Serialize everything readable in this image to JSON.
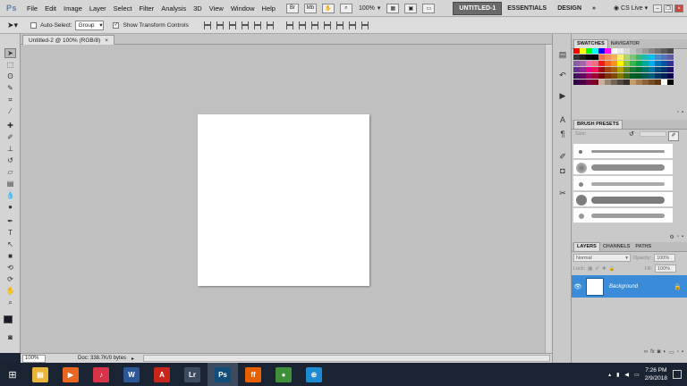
{
  "app": {
    "logo": "Ps"
  },
  "menu": [
    "File",
    "Edit",
    "Image",
    "Layer",
    "Select",
    "Filter",
    "Analysis",
    "3D",
    "View",
    "Window",
    "Help"
  ],
  "zoom_menu": "100%",
  "workspaces": {
    "active": "UNTITLED-1",
    "essentials": "ESSENTIALS",
    "design": "DESIGN",
    "more": "»"
  },
  "cs_live": "CS Live",
  "options": {
    "auto_select_label": "Auto-Select:",
    "auto_select_value": "Group",
    "show_transform_label": "Show Transform Controls",
    "show_transform_checked": "✓"
  },
  "document": {
    "tab_title": "Untitled-2 @ 100% (RGB/8)",
    "close": "×"
  },
  "status": {
    "zoom": "100%",
    "doc_info": "Doc: 338.7K/0 bytes",
    "arrow": "▸"
  },
  "panels": {
    "swatches_tab": "SWATCHES",
    "navigator_tab": "NAVIGATOR",
    "brush_presets_tab": "BRUSH PRESETS",
    "brush_size_label": "Size:",
    "layers_tab": "LAYERS",
    "channels_tab": "CHANNELS",
    "paths_tab": "PATHS",
    "blend_mode": "Normal",
    "opacity_label": "Opacity:",
    "opacity_value": "100%",
    "lock_label": "Lock:",
    "fill_label": "Fill:",
    "fill_value": "100%",
    "layer_name": "Background"
  },
  "swatch_colors": [
    "#ff0000",
    "#ffff00",
    "#00ff00",
    "#00ffff",
    "#0000ff",
    "#ff00ff",
    "#ffffff",
    "#ebebeb",
    "#d6d6d6",
    "#c2c2c2",
    "#adadad",
    "#999999",
    "#858585",
    "#707070",
    "#5c5c5c",
    "#474747",
    "#333333",
    "#1f1f1f",
    "#0a0a0a",
    "#000000",
    "#f26c4f",
    "#f68e55",
    "#fbaf5c",
    "#fff467",
    "#acd372",
    "#7cc576",
    "#3bb878",
    "#1abbb4",
    "#00bff3",
    "#438ccb",
    "#5574b9",
    "#605ca8",
    "#855fa8",
    "#a763a9",
    "#ef6ea8",
    "#f16d7e",
    "#ed1c24",
    "#f26522",
    "#f7941d",
    "#fff200",
    "#8dc63f",
    "#39b54a",
    "#00a651",
    "#00a99d",
    "#00aeef",
    "#0072bc",
    "#0054a6",
    "#2e3192",
    "#662d91",
    "#92278f",
    "#ec008c",
    "#ed145b",
    "#9e0b0f",
    "#a0410d",
    "#a36209",
    "#aba000",
    "#598527",
    "#1a7b30",
    "#007236",
    "#00746b",
    "#0076a3",
    "#004a80",
    "#003471",
    "#1b1464",
    "#440e62",
    "#630460",
    "#9e005d",
    "#9e0039",
    "#790000",
    "#7b2e00",
    "#7d4900",
    "#827b00",
    "#406618",
    "#005e20",
    "#005826",
    "#005952",
    "#005b7f",
    "#003663",
    "#002157",
    "#0d004c",
    "#32004b",
    "#4b0049",
    "#7b0046",
    "#7a0026",
    "#c7b299",
    "#998675",
    "#736357",
    "#534741",
    "#37302d",
    "#c69c6d",
    "#a67c52",
    "#8c6239",
    "#754c24",
    "#603913",
    "#ffffff",
    "#000000"
  ],
  "taskbar": {
    "time": "7:26 PM",
    "date": "2/9/2018",
    "apps": [
      {
        "name": "file-explorer",
        "glyph": "▤",
        "color": "#e8b53a"
      },
      {
        "name": "media-player",
        "glyph": "▶",
        "color": "#e8661f"
      },
      {
        "name": "itunes",
        "glyph": "♪",
        "color": "#d9324b"
      },
      {
        "name": "word-app",
        "glyph": "W",
        "color": "#2b5797"
      },
      {
        "name": "acrobat-app",
        "glyph": "A",
        "color": "#c7261c"
      },
      {
        "name": "lightroom-app",
        "glyph": "Lr",
        "color": "#3b4c5e"
      },
      {
        "name": "photoshop-app",
        "glyph": "Ps",
        "color": "#0f4e7a"
      },
      {
        "name": "firefox-app",
        "glyph": "ff",
        "color": "#e66000"
      },
      {
        "name": "chrome-app",
        "glyph": "●",
        "color": "#3f8f3a"
      },
      {
        "name": "hp-app",
        "glyph": "⊕",
        "color": "#1d8ad1"
      }
    ]
  }
}
